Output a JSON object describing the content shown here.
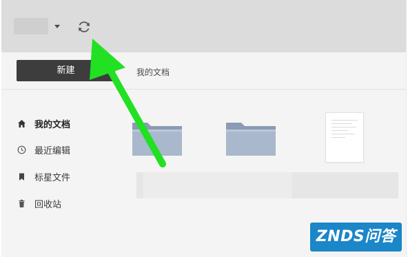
{
  "toolbar": {
    "new_label": "新建",
    "breadcrumb": "我的文档"
  },
  "sidebar": {
    "items": [
      {
        "label": "我的文档",
        "icon": "home-icon",
        "active": true
      },
      {
        "label": "最近编辑",
        "icon": "clock-icon",
        "active": false
      },
      {
        "label": "标星文件",
        "icon": "bookmark-icon",
        "active": false
      },
      {
        "label": "回收站",
        "icon": "trash-icon",
        "active": false
      }
    ]
  },
  "content": {
    "items": [
      {
        "type": "folder",
        "icon": "folder-icon"
      },
      {
        "type": "folder",
        "icon": "folder-icon"
      },
      {
        "type": "document",
        "icon": "document-thumbnail"
      }
    ]
  },
  "annotation": {
    "icon": "green-arrow-icon",
    "color": "#22e022"
  },
  "watermark": {
    "text": "ZNDS问答"
  },
  "colors": {
    "titlebar": "#dcdcdc",
    "button_dark": "#3d3d3d",
    "folder": "#9fb0c6",
    "watermark": "#1b86c8"
  }
}
